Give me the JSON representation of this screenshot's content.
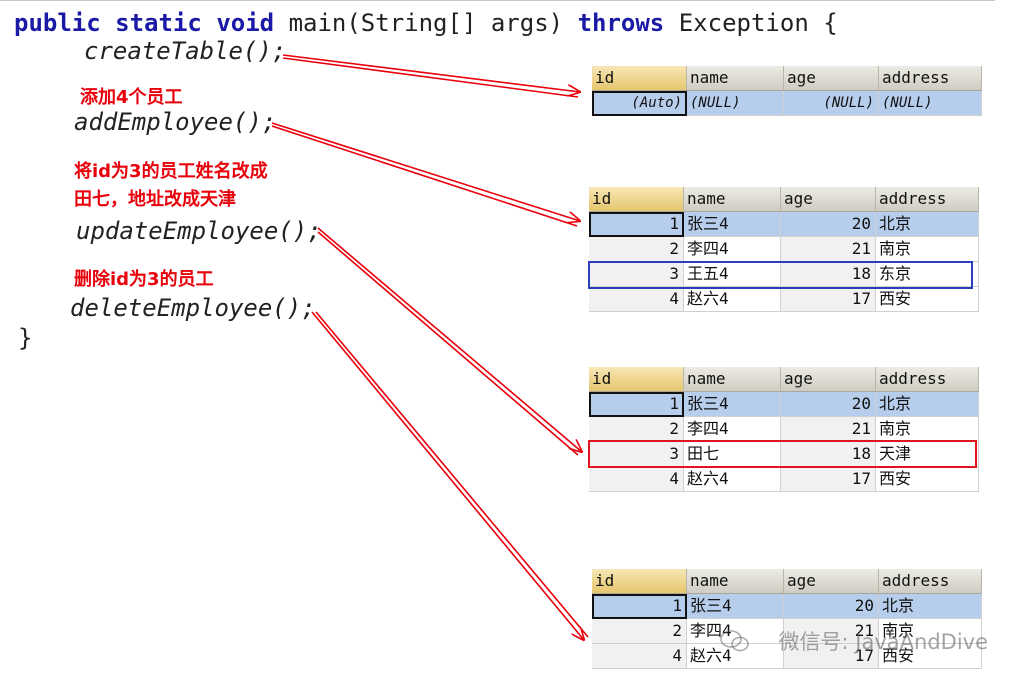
{
  "code": {
    "line1_kw1": "public",
    "line1_kw2": "static",
    "line1_kw3": "void",
    "line1_rest": "main(String[] args)",
    "line1_kw4": "throws",
    "line1_tail": "Exception {",
    "call_create": "createTable();",
    "call_add": "addEmployee();",
    "call_update": "updateEmployee();",
    "call_delete": "deleteEmployee();",
    "close_brace": "}"
  },
  "notes": {
    "add": "添加4个员工",
    "update_l1": "将id为3的员工姓名改成",
    "update_l2": "田七，地址改成天津",
    "delete": "删除id为3的员工"
  },
  "headers": [
    "id",
    "name",
    "age",
    "address"
  ],
  "tables": {
    "t1": {
      "rows": [
        [
          "(Auto)",
          "(NULL)",
          "(NULL)",
          "(NULL)"
        ]
      ]
    },
    "t2": {
      "rows": [
        [
          "1",
          "张三4",
          "20",
          "北京"
        ],
        [
          "2",
          "李四4",
          "21",
          "南京"
        ],
        [
          "3",
          "王五4",
          "18",
          "东京"
        ],
        [
          "4",
          "赵六4",
          "17",
          "西安"
        ]
      ]
    },
    "t3": {
      "rows": [
        [
          "1",
          "张三4",
          "20",
          "北京"
        ],
        [
          "2",
          "李四4",
          "21",
          "南京"
        ],
        [
          "3",
          "田七",
          "18",
          "天津"
        ],
        [
          "4",
          "赵六4",
          "17",
          "西安"
        ]
      ]
    },
    "t4": {
      "rows": [
        [
          "1",
          "张三4",
          "20",
          "北京"
        ],
        [
          "2",
          "李四4",
          "21",
          "南京"
        ],
        [
          "4",
          "赵六4",
          "17",
          "西安"
        ]
      ]
    }
  },
  "watermark": "微信号: JavaAndDive",
  "colors": {
    "arrow": "#e8000b",
    "keyword": "#1a1aa6",
    "selected_row": "#b7cdec",
    "highlight_blue": "#2b3fb8",
    "highlight_red": "#e0141e"
  }
}
